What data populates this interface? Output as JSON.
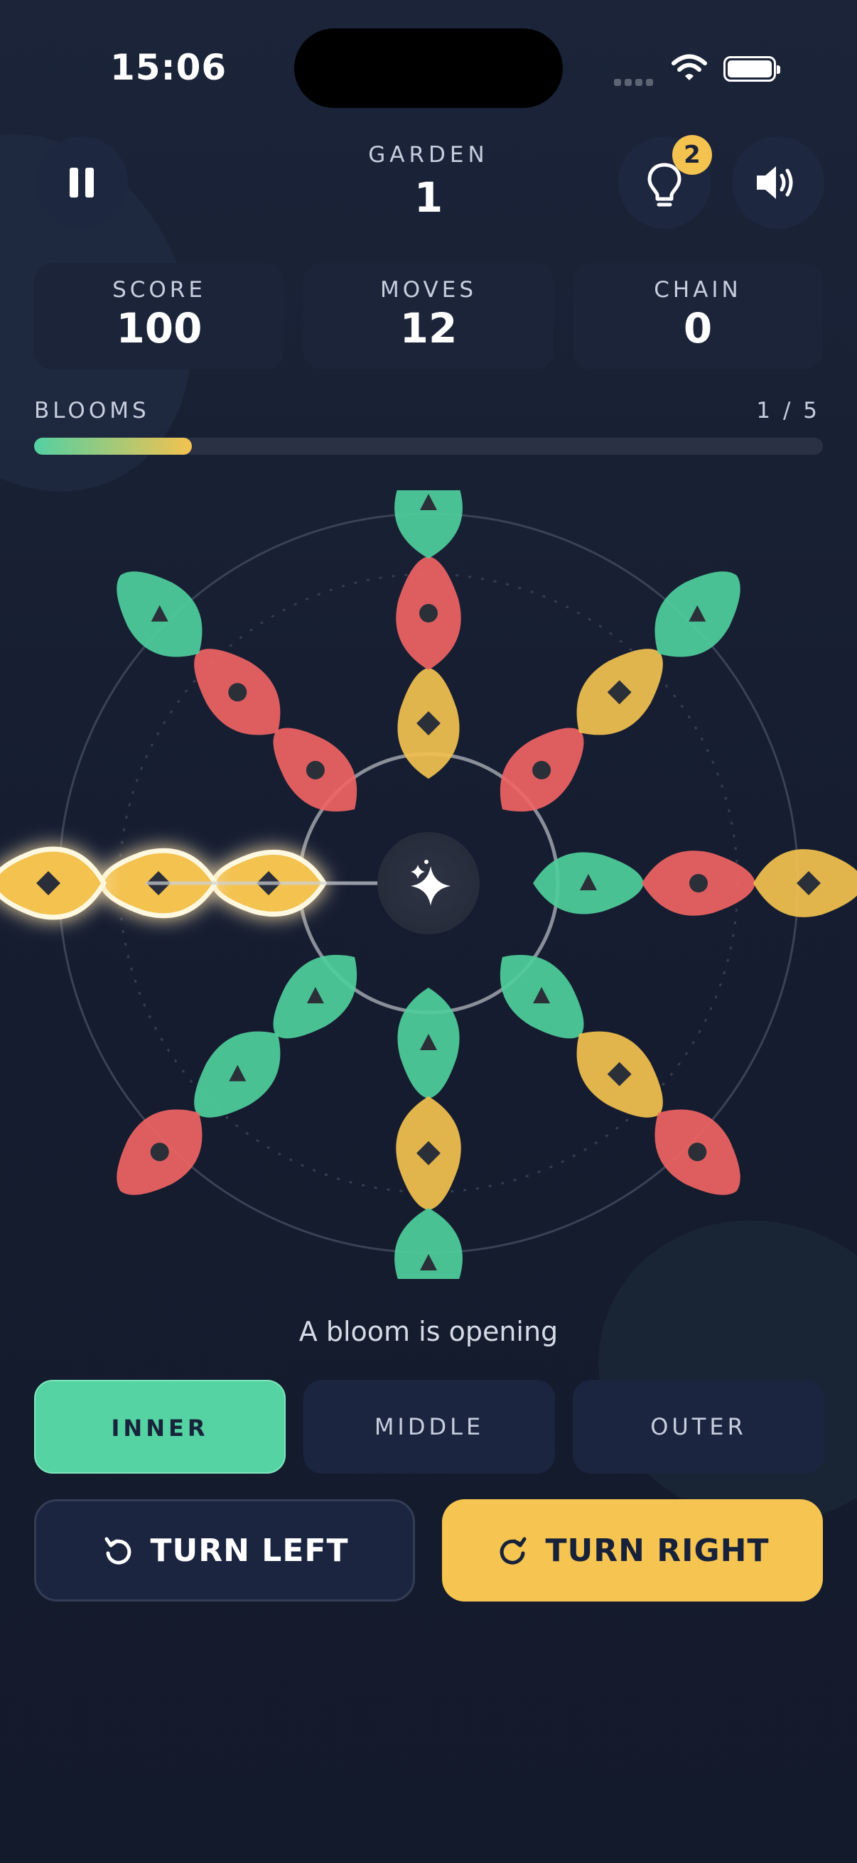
{
  "status": {
    "time": "15:06"
  },
  "header": {
    "garden_label": "GARDEN",
    "garden_value": "1",
    "hint_count": "2"
  },
  "stats": [
    {
      "label": "SCORE",
      "value": "100"
    },
    {
      "label": "MOVES",
      "value": "12"
    },
    {
      "label": "CHAIN",
      "value": "0"
    }
  ],
  "progress": {
    "label": "BLOOMS",
    "count_text": "1 / 5",
    "fraction": 0.2
  },
  "colors": {
    "green": "#4fcf9c",
    "red": "#f06464",
    "yellow": "#f3c24f",
    "accent": "#55d3a3"
  },
  "board": {
    "petals": [
      {
        "arm": 0,
        "ring": 0,
        "color": "yellow",
        "symbol": "diamond",
        "highlighted": true
      },
      {
        "arm": 0,
        "ring": 1,
        "color": "yellow",
        "symbol": "diamond",
        "highlighted": true
      },
      {
        "arm": 0,
        "ring": 2,
        "color": "yellow",
        "symbol": "diamond",
        "highlighted": true
      },
      {
        "arm": 1,
        "ring": 0,
        "color": "red",
        "symbol": "circle"
      },
      {
        "arm": 1,
        "ring": 1,
        "color": "red",
        "symbol": "circle"
      },
      {
        "arm": 1,
        "ring": 2,
        "color": "green",
        "symbol": "triangle"
      },
      {
        "arm": 2,
        "ring": 0,
        "color": "yellow",
        "symbol": "diamond"
      },
      {
        "arm": 2,
        "ring": 1,
        "color": "red",
        "symbol": "circle"
      },
      {
        "arm": 2,
        "ring": 2,
        "color": "green",
        "symbol": "triangle"
      },
      {
        "arm": 3,
        "ring": 0,
        "color": "red",
        "symbol": "circle"
      },
      {
        "arm": 3,
        "ring": 1,
        "color": "yellow",
        "symbol": "diamond"
      },
      {
        "arm": 3,
        "ring": 2,
        "color": "green",
        "symbol": "triangle"
      },
      {
        "arm": 4,
        "ring": 0,
        "color": "green",
        "symbol": "triangle"
      },
      {
        "arm": 4,
        "ring": 1,
        "color": "red",
        "symbol": "circle"
      },
      {
        "arm": 4,
        "ring": 2,
        "color": "yellow",
        "symbol": "diamond"
      },
      {
        "arm": 5,
        "ring": 0,
        "color": "green",
        "symbol": "triangle"
      },
      {
        "arm": 5,
        "ring": 1,
        "color": "yellow",
        "symbol": "diamond"
      },
      {
        "arm": 5,
        "ring": 2,
        "color": "red",
        "symbol": "circle"
      },
      {
        "arm": 6,
        "ring": 0,
        "color": "green",
        "symbol": "triangle"
      },
      {
        "arm": 6,
        "ring": 1,
        "color": "yellow",
        "symbol": "diamond"
      },
      {
        "arm": 6,
        "ring": 2,
        "color": "green",
        "symbol": "triangle"
      },
      {
        "arm": 7,
        "ring": 0,
        "color": "green",
        "symbol": "triangle"
      },
      {
        "arm": 7,
        "ring": 1,
        "color": "green",
        "symbol": "triangle"
      },
      {
        "arm": 7,
        "ring": 2,
        "color": "red",
        "symbol": "circle"
      }
    ]
  },
  "message": "A bloom is opening",
  "ring_buttons": [
    {
      "label": "INNER",
      "active": true
    },
    {
      "label": "MIDDLE",
      "active": false
    },
    {
      "label": "OUTER",
      "active": false
    }
  ],
  "turn_left_label": "TURN LEFT",
  "turn_right_label": "TURN RIGHT"
}
